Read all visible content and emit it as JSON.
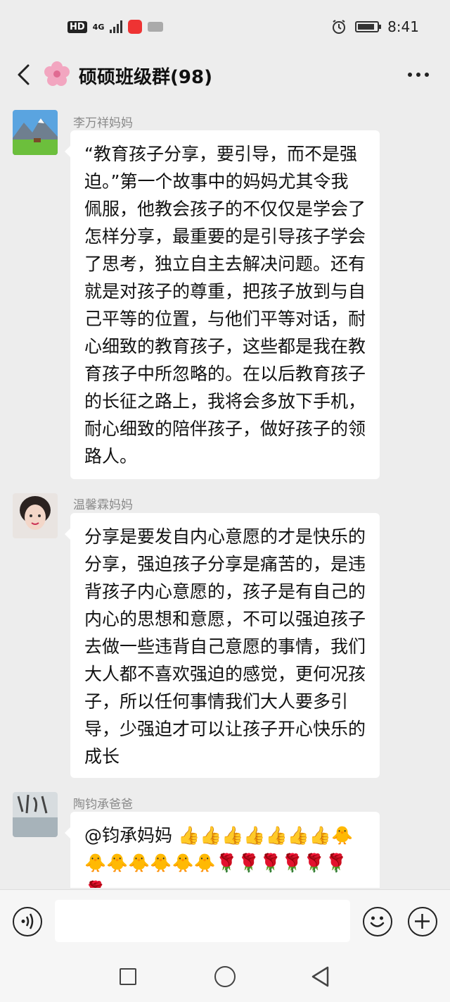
{
  "status_bar": {
    "hd": "HD",
    "network": "4G",
    "time": "8:41",
    "battery_level": 0.9
  },
  "header": {
    "title": "硕硕班级群(98)",
    "back_icon": "chevron-left-icon",
    "group_icon": "flower-icon",
    "more_icon": "more-dots-icon"
  },
  "messages": [
    {
      "sender": "李万祥妈妈",
      "avatar": "mountain-landscape-avatar",
      "text": "“教育孩子分享，要引导，而不是强迫。”第一个故事中的妈妈尤其令我佩服，他教会孩子的不仅仅是学会了怎样分享，最重要的是引导孩子学会了思考，独立自主去解决问题。还有就是对孩子的尊重，把孩子放到与自己平等的位置，与他们平等对话，耐心细致的教育孩子，这些都是我在教育孩子中所忽略的。在以后教育孩子的长征之路上，我将会多放下手机，耐心细致的陪伴孩子，做好孩子的领路人。"
    },
    {
      "sender": "温馨霖妈妈",
      "avatar": "woman-portrait-avatar",
      "text": "分享是要发自内心意愿的才是快乐的分享，强迫孩子分享是痛苦的，是违背孩子内心意愿的，孩子是有自己的内心的思想和意愿，不可以强迫孩子去做一些违背自己意愿的事情，我们大人都不喜欢强迫的感觉，更何况孩子，所以任何事情我们大人要多引导，少强迫才可以让孩子开心快乐的成长"
    },
    {
      "sender": "陶钧承爸爸",
      "avatar": "calligraphy-book-avatar",
      "text": "@钧承妈妈",
      "emojis": [
        "👍",
        "👍",
        "👍",
        "👍",
        "👍",
        "👍",
        "👍",
        "🐥",
        "🐥",
        "🐥",
        "🐥",
        "🐥",
        "🐥",
        "🐥",
        "🌹",
        "🌹",
        "🌹",
        "🌹",
        "🌹",
        "🌹",
        "🌹"
      ]
    }
  ],
  "input_bar": {
    "voice_icon": "voice-icon",
    "emoji_icon": "emoji-icon",
    "plus_icon": "plus-icon",
    "placeholder": ""
  },
  "nav_bar": {
    "recent_icon": "square-icon",
    "home_icon": "circle-icon",
    "back_icon": "triangle-back-icon"
  }
}
